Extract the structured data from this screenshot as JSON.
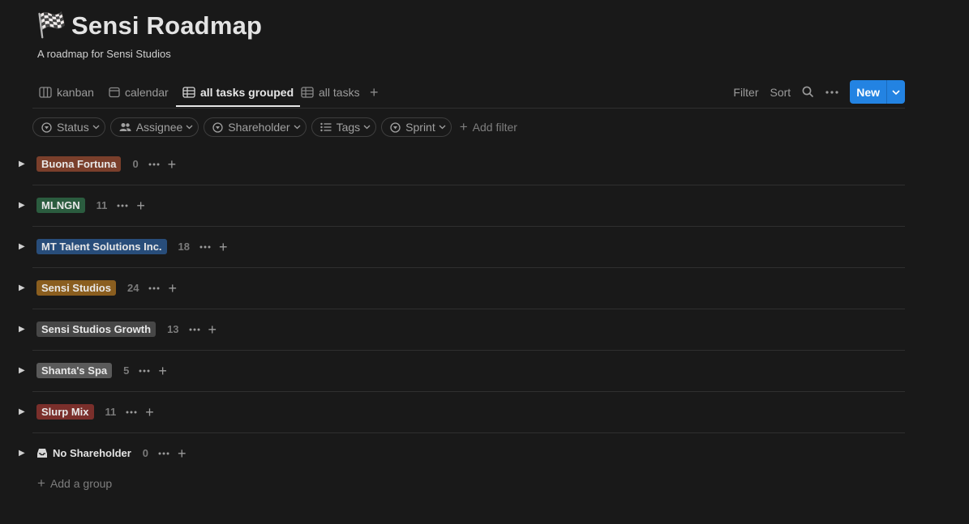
{
  "header": {
    "emoji": "🏁",
    "title": "Sensi Roadmap",
    "subtitle": "A roadmap for Sensi Studios"
  },
  "tabs": [
    {
      "label": "kanban",
      "icon": "board-icon"
    },
    {
      "label": "calendar",
      "icon": "calendar-icon"
    },
    {
      "label": "all tasks grouped",
      "icon": "table-icon",
      "active": true
    },
    {
      "label": "all tasks",
      "icon": "table-icon"
    }
  ],
  "actions": {
    "filter": "Filter",
    "sort": "Sort",
    "new": "New"
  },
  "filters": [
    {
      "label": "Status",
      "icon": "status-icon"
    },
    {
      "label": "Assignee",
      "icon": "people-icon"
    },
    {
      "label": "Shareholder",
      "icon": "status-icon"
    },
    {
      "label": "Tags",
      "icon": "list-icon"
    },
    {
      "label": "Sprint",
      "icon": "status-icon"
    }
  ],
  "add_filter": "Add filter",
  "groups": [
    {
      "name": "Buona Fortuna",
      "count": "0",
      "color": "#7a3f2b"
    },
    {
      "name": "MLNGN",
      "count": "11",
      "color": "#2b5c3f"
    },
    {
      "name": "MT Talent Solutions Inc.",
      "count": "18",
      "color": "#284d7a"
    },
    {
      "name": "Sensi Studios",
      "count": "24",
      "color": "#8a5e1f"
    },
    {
      "name": "Sensi Studios Growth",
      "count": "13",
      "color": "#474747"
    },
    {
      "name": "Shanta's Spa",
      "count": "5",
      "color": "#5a5a5a"
    },
    {
      "name": "Slurp Mix",
      "count": "11",
      "color": "#7a2f2b"
    }
  ],
  "no_group": {
    "name": "No Shareholder",
    "count": "0"
  },
  "add_group": "Add a group"
}
